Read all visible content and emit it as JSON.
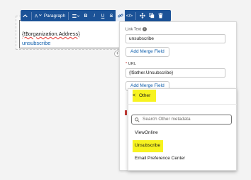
{
  "editor": {
    "merge_field": "{!$organization.Address}",
    "link_text": "unsubscribe"
  },
  "toolbar": {
    "paragraph_label": "Paragraph"
  },
  "panel": {
    "link_text_label": "Link Text",
    "link_text_value": "unsubscribe",
    "add_merge_field_1": "Add Merge Field",
    "url_label": "URL",
    "url_required_marker": "*",
    "url_value": "{!$other.Unsubscribe}",
    "add_merge_field_2": "Add Merge Field"
  },
  "dropdown": {
    "back_glyph": "<",
    "title": "Other",
    "search_placeholder": "Search Other metadata",
    "options": [
      "ViewOnline",
      "Unsubscribe",
      "Email Preference Center"
    ]
  },
  "colors": {
    "toolbar_bg": "#1b5297",
    "link": "#0b5cab",
    "highlight": "#f7f320",
    "required": "#c23934"
  }
}
